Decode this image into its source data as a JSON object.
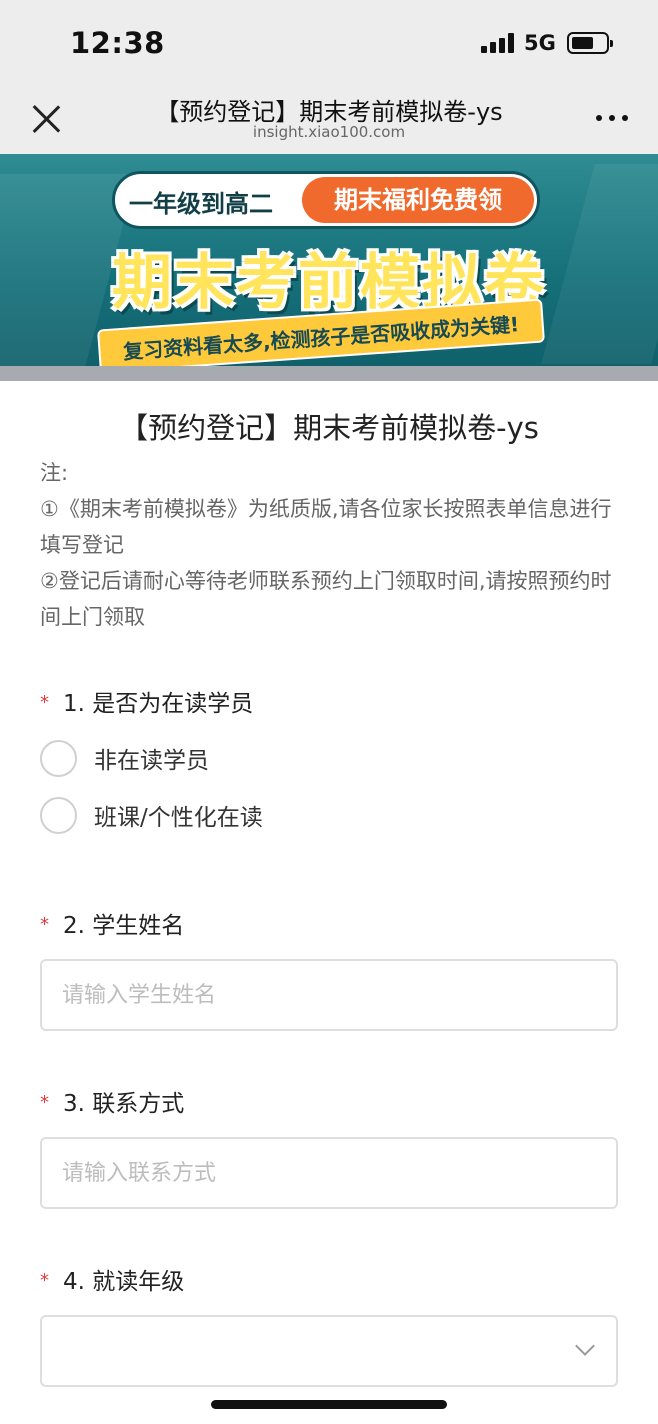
{
  "status_bar": {
    "time": "12:38",
    "network": "5G",
    "battery_level": 0.65
  },
  "nav": {
    "title": "【预约登记】期末考前模拟卷-ys",
    "url": "insight.xiao100.com",
    "close_icon": "close-icon",
    "more_icon": "more-icon"
  },
  "banner": {
    "pill_left": "一年级到高二",
    "pill_right": "期末福利免费领",
    "title": "期末考前模拟卷",
    "subtitle": "复习资料看太多,检测孩子是否吸收成为关键!"
  },
  "form": {
    "title": "【预约登记】期末考前模拟卷-ys",
    "note": [
      "注:",
      "①《期末考前模拟卷》为纸质版,请各位家长按照表单信息进行填写登记",
      "②登记后请耐心等待老师联系预约上门领取时间,请按照预约时间上门领取"
    ],
    "required_mark": "*",
    "questions": [
      {
        "label": "1. 是否为在读学员",
        "options": [
          "非在读学员",
          "班课/个性化在读"
        ]
      },
      {
        "label": "2. 学生姓名",
        "placeholder": "请输入学生姓名"
      },
      {
        "label": "3. 联系方式",
        "placeholder": "请输入联系方式"
      },
      {
        "label": "4. 就读年级",
        "value": ""
      }
    ]
  },
  "colors": {
    "required": "#e23b3b",
    "banner_teal": "#15707a",
    "banner_orange": "#ef6a2c",
    "banner_yellow": "#ffe45c"
  }
}
